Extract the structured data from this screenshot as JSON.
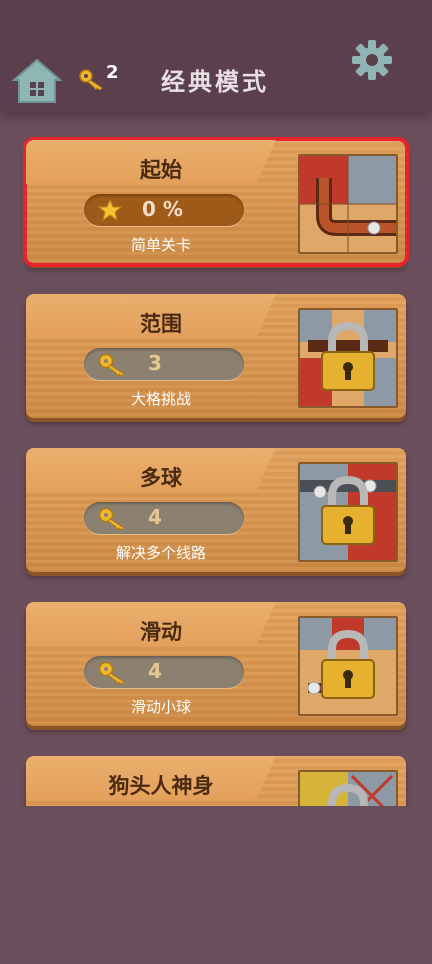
{
  "header": {
    "title": "经典模式",
    "key_count": "2"
  },
  "levels": [
    {
      "name": "起始",
      "value": "0 %",
      "subtitle": "简单关卡",
      "selected": true,
      "locked": false,
      "value_icon": "star-icon"
    },
    {
      "name": "范围",
      "value": "3",
      "subtitle": "大格挑战",
      "selected": false,
      "locked": true,
      "value_icon": "key-icon"
    },
    {
      "name": "多球",
      "value": "4",
      "subtitle": "解决多个线路",
      "selected": false,
      "locked": true,
      "value_icon": "key-icon"
    },
    {
      "name": "滑动",
      "value": "4",
      "subtitle": "滑动小球",
      "selected": false,
      "locked": true,
      "value_icon": "key-icon"
    },
    {
      "name": "狗头人神身",
      "value": "",
      "subtitle": "",
      "selected": false,
      "locked": true,
      "value_icon": "key-icon"
    }
  ],
  "colors": {
    "background": "#6b4e5c",
    "selected_outline": "#e8232b",
    "card_wood": "#dc9a52"
  }
}
